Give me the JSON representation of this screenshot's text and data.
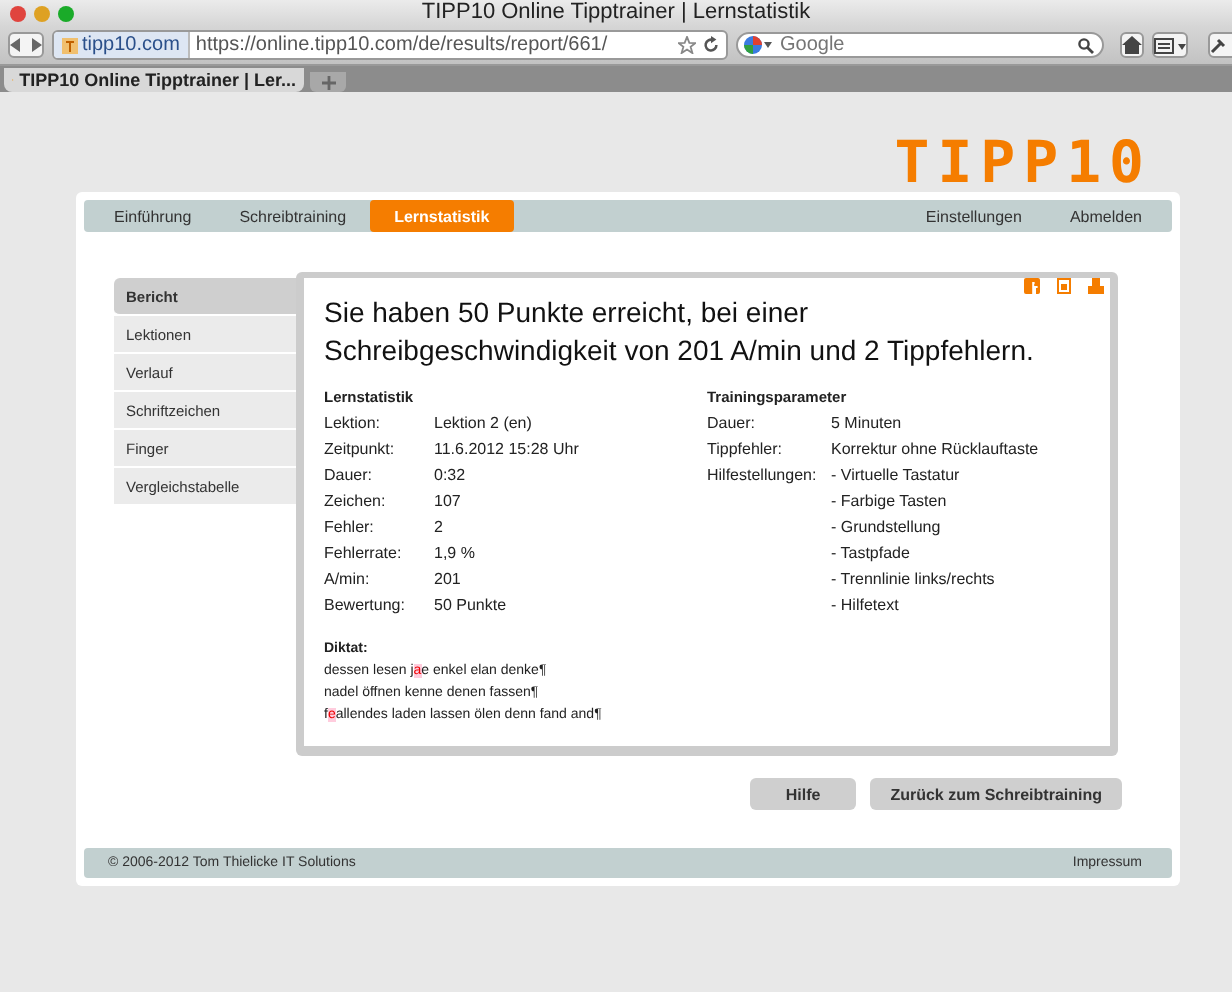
{
  "window": {
    "title": "TIPP10 Online Tipptrainer | Lernstatistik"
  },
  "toolbar": {
    "site_identity": "tipp10.com",
    "url": "https://online.tipp10.com/de/results/report/661/",
    "search_placeholder": "Google"
  },
  "tabs": [
    {
      "label": "TIPP10 Online Tipptrainer | Ler...",
      "selected": true
    }
  ],
  "logo": "TIPP10",
  "nav": {
    "left": [
      {
        "label": "Einführung",
        "selected": false
      },
      {
        "label": "Schreibtraining",
        "selected": false
      },
      {
        "label": "Lernstatistik",
        "selected": true
      }
    ],
    "right": [
      {
        "label": "Einstellungen",
        "selected": false
      },
      {
        "label": "Abmelden",
        "selected": false
      }
    ]
  },
  "sidebar": [
    {
      "label": "Bericht",
      "selected": true
    },
    {
      "label": "Lektionen",
      "selected": false
    },
    {
      "label": "Verlauf",
      "selected": false
    },
    {
      "label": "Schriftzeichen",
      "selected": false
    },
    {
      "label": "Finger",
      "selected": false
    },
    {
      "label": "Vergleichstabelle",
      "selected": false
    }
  ],
  "report": {
    "headline": "Sie haben 50 Punkte erreicht, bei einer Schreibgeschwindigkeit von 201 A/min und 2 Tippfehlern.",
    "stats": {
      "title": "Lernstatistik",
      "rows": [
        {
          "label": "Lektion:",
          "value": "Lektion 2 (en)"
        },
        {
          "label": "Zeitpunkt:",
          "value": "11.6.2012 15:28 Uhr"
        },
        {
          "label": "Dauer:",
          "value": "0:32"
        },
        {
          "label": "Zeichen:",
          "value": "107"
        },
        {
          "label": "Fehler:",
          "value": "2"
        },
        {
          "label": "Fehlerrate:",
          "value": "1,9 %"
        },
        {
          "label": "A/min:",
          "value": "201"
        },
        {
          "label": "Bewertung:",
          "value": "50 Punkte"
        }
      ]
    },
    "params": {
      "title": "Trainingsparameter",
      "rows": [
        {
          "label": "Dauer:",
          "values": [
            "5 Minuten"
          ]
        },
        {
          "label": "Tippfehler:",
          "values": [
            "Korrektur ohne Rücklauftaste"
          ]
        },
        {
          "label": "Hilfestellungen:",
          "values": [
            "- Virtuelle Tastatur",
            "- Farbige Tasten",
            "- Grundstellung",
            "- Tastpfade",
            "- Trennlinie links/rechts",
            "- Hilfetext"
          ]
        }
      ]
    },
    "diktat": {
      "title": "Diktat:",
      "lines": [
        [
          {
            "text": "dessen lesen j",
            "error": false
          },
          {
            "text": "a",
            "error": true
          },
          {
            "text": "e enkel elan denke¶",
            "error": false
          }
        ],
        [
          {
            "text": "nadel öffnen kenne denen fassen¶",
            "error": false
          }
        ],
        [
          {
            "text": "f",
            "error": false
          },
          {
            "text": "e",
            "error": true
          },
          {
            "text": "allendes laden lassen ölen denn fand and¶",
            "error": false
          }
        ]
      ]
    }
  },
  "buttons": [
    {
      "label": "Hilfe"
    },
    {
      "label": "Zurück zum Schreibtraining"
    }
  ],
  "footer": {
    "copyright": "© 2006-2012 Tom Thielicke IT Solutions",
    "link": "Impressum"
  }
}
